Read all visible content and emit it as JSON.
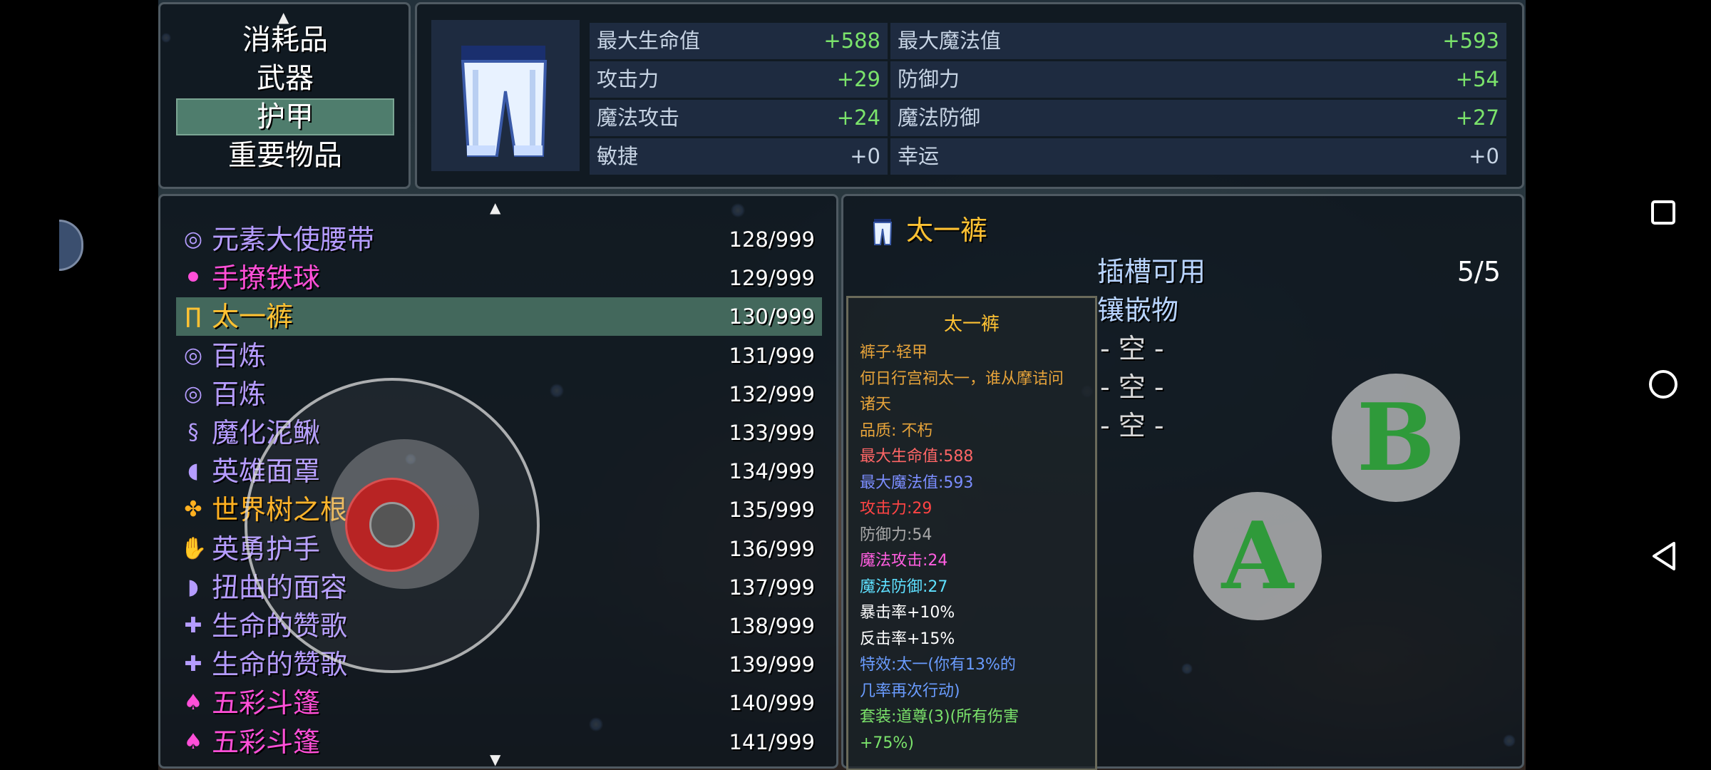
{
  "categories": {
    "up_arrow": "▲",
    "items": [
      {
        "label": "消耗品",
        "selected": false
      },
      {
        "label": "武器",
        "selected": false
      },
      {
        "label": "护甲",
        "selected": true
      },
      {
        "label": "重要物品",
        "selected": false
      }
    ]
  },
  "stats": {
    "left": [
      {
        "label": "最大生命值",
        "value": "+588"
      },
      {
        "label": "攻击力",
        "value": "+29"
      },
      {
        "label": "魔法攻击",
        "value": "+24"
      },
      {
        "label": "敏捷",
        "value": "+0"
      }
    ],
    "right": [
      {
        "label": "最大魔法值",
        "value": "+593"
      },
      {
        "label": "防御力",
        "value": "+54"
      },
      {
        "label": "魔法防御",
        "value": "+27"
      },
      {
        "label": "幸运",
        "value": "+0"
      }
    ]
  },
  "item_list": {
    "up_arrow": "▲",
    "down_arrow": "▼",
    "rows": [
      {
        "icon": "belt-icon",
        "glyph": "◎",
        "name": "元素大使腰带",
        "count": "128/999",
        "color": "#b59cff",
        "selected": false
      },
      {
        "icon": "chain-ball-icon",
        "glyph": "⚫",
        "name": "手撩铁球",
        "count": "129/999",
        "color": "#ff4fd8",
        "selected": false
      },
      {
        "icon": "pants-icon",
        "glyph": "∏",
        "name": "太一裤",
        "count": "130/999",
        "color": "#ffc233",
        "selected": true
      },
      {
        "icon": "ring-belt-icon",
        "glyph": "◎",
        "name": "百炼",
        "count": "131/999",
        "color": "#b59cff",
        "selected": false
      },
      {
        "icon": "ring-belt-icon",
        "glyph": "◎",
        "name": "百炼",
        "count": "132/999",
        "color": "#b59cff",
        "selected": false
      },
      {
        "icon": "eel-icon",
        "glyph": "§",
        "name": "魔化泥鳅",
        "count": "133/999",
        "color": "#b59cff",
        "selected": false
      },
      {
        "icon": "mask-icon",
        "glyph": "◖",
        "name": "英雄面罩",
        "count": "134/999",
        "color": "#b59cff",
        "selected": false
      },
      {
        "icon": "root-icon",
        "glyph": "✤",
        "name": "世界树之根",
        "count": "135/999",
        "color": "#ffb020",
        "selected": false
      },
      {
        "icon": "gauntlet-icon",
        "glyph": "✋",
        "name": "英勇护手",
        "count": "136/999",
        "color": "#b59cff",
        "selected": false
      },
      {
        "icon": "hood-icon",
        "glyph": "◗",
        "name": "扭曲的面容",
        "count": "137/999",
        "color": "#b59cff",
        "selected": false
      },
      {
        "icon": "amulet-icon",
        "glyph": "✚",
        "name": "生命的赞歌",
        "count": "138/999",
        "color": "#b59cff",
        "selected": false
      },
      {
        "icon": "amulet-icon",
        "glyph": "✚",
        "name": "生命的赞歌",
        "count": "139/999",
        "color": "#b59cff",
        "selected": false
      },
      {
        "icon": "cloak-icon",
        "glyph": "♠",
        "name": "五彩斗篷",
        "count": "140/999",
        "color": "#ff4fd8",
        "selected": false
      },
      {
        "icon": "cloak-icon",
        "glyph": "♠",
        "name": "五彩斗篷",
        "count": "141/999",
        "color": "#ff4fd8",
        "selected": false
      }
    ]
  },
  "detail": {
    "name": "太一裤",
    "sockets_label": "插槽可用",
    "sockets_count": "5/5",
    "inlay_label": "镶嵌物",
    "empty_slots": [
      "- 空 -",
      "- 空 -",
      "- 空 -"
    ],
    "card": {
      "title": "太一裤",
      "lines": [
        {
          "text": "裤子·轻甲",
          "color": "#e6a33a"
        },
        {
          "text": "何日行宫祠太一，谁从摩诘问",
          "color": "#e6a33a"
        },
        {
          "text": "诸天",
          "color": "#e6a33a"
        },
        {
          "text": "品质: 不朽",
          "color": "#e6a33a"
        },
        {
          "text": "最大生命值:588",
          "color": "#ff6666"
        },
        {
          "text": "最大魔法值:593",
          "color": "#7b8dff"
        },
        {
          "text": "攻击力:29",
          "color": "#ff4444"
        },
        {
          "text": "防御力:54",
          "color": "#a8a8a8"
        },
        {
          "text": "魔法攻击:24",
          "color": "#ff5ee0"
        },
        {
          "text": "魔法防御:27",
          "color": "#5ee0ff"
        },
        {
          "text": "暴击率+10%",
          "color": "#ffffff"
        },
        {
          "text": "反击率+15%",
          "color": "#ffffff"
        },
        {
          "text": "特效:太一(你有13%的",
          "color": "#6a9cff"
        },
        {
          "text": "几率再次行动)",
          "color": "#6a9cff"
        },
        {
          "text": "套装:道尊(3)(所有伤害",
          "color": "#7be36b"
        },
        {
          "text": "+75%)",
          "color": "#7be36b"
        }
      ]
    }
  },
  "controls": {
    "button_a": "A",
    "button_b": "B"
  },
  "nav": {
    "recents": "recents-icon",
    "home": "home-icon",
    "back": "back-icon"
  }
}
